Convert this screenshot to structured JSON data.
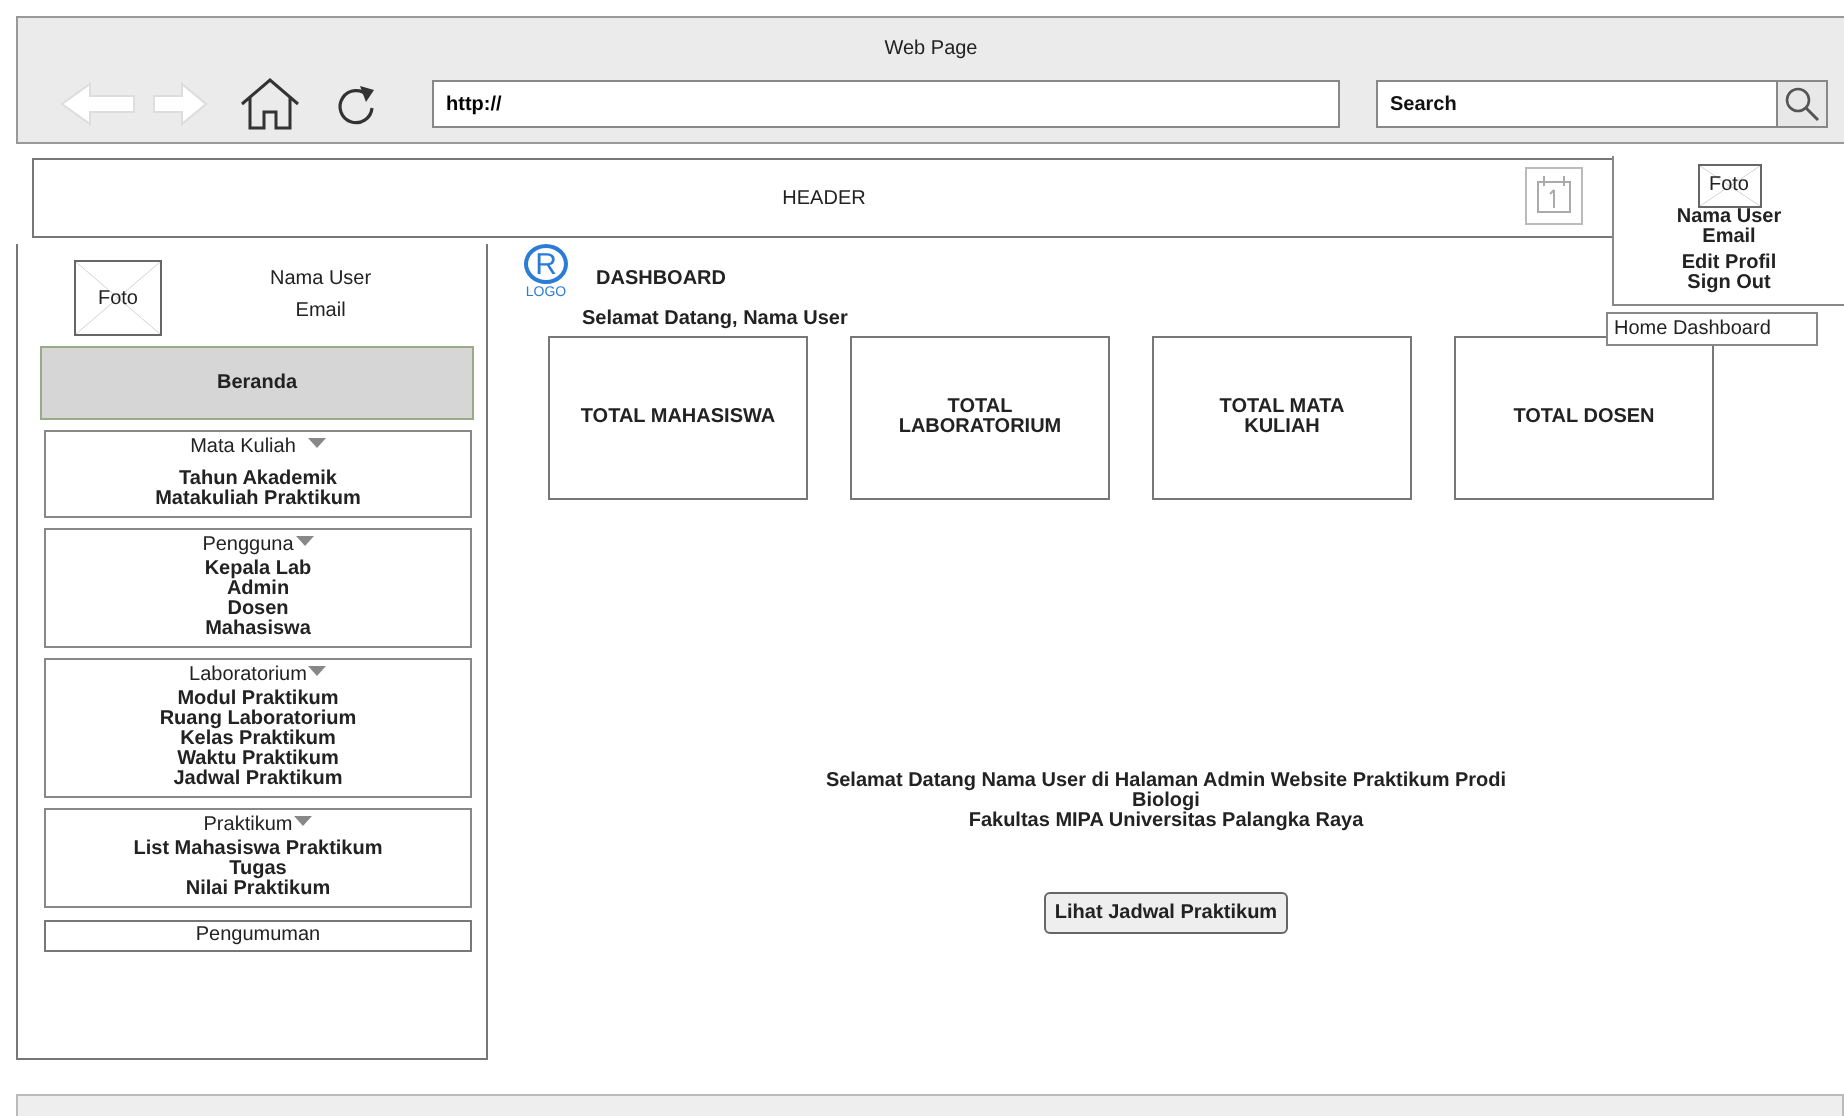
{
  "browser": {
    "title": "Web Page",
    "address": "http://",
    "search_placeholder": "Search"
  },
  "header": {
    "title": "HEADER"
  },
  "profile_menu": {
    "photo_label": "Foto",
    "name": "Nama User",
    "email": "Email",
    "items": [
      "Edit Profil",
      "Sign Out"
    ]
  },
  "home_link": "Home Dashboard",
  "sidebar": {
    "photo_label": "Foto",
    "name": "Nama User",
    "email": "Email",
    "menu": [
      {
        "kind": "link",
        "label": "Beranda",
        "selected": true
      },
      {
        "kind": "group",
        "label": "Mata Kuliah",
        "selected": false,
        "children": [
          {
            "label": "Tahun Akademik"
          },
          {
            "label": "Matakuliah Praktikum"
          }
        ]
      },
      {
        "kind": "group",
        "label": "Pengguna",
        "selected": false,
        "children": [
          {
            "label": "Kepala Lab"
          },
          {
            "label": "Admin"
          },
          {
            "label": "Dosen"
          },
          {
            "label": "Mahasiswa"
          }
        ]
      },
      {
        "kind": "group",
        "label": "Laboratorium",
        "selected": false,
        "children": [
          {
            "label": "Modul Praktikum"
          },
          {
            "label": "Ruang Laboratorium"
          },
          {
            "label": "Kelas Praktikum"
          },
          {
            "label": "Waktu Praktikum"
          },
          {
            "label": "Jadwal Praktikum"
          }
        ]
      },
      {
        "kind": "group",
        "label": "Praktikum",
        "selected": false,
        "children": [
          {
            "label": "List Mahasiswa Praktikum"
          },
          {
            "label": "Tugas"
          },
          {
            "label": "Nilai Praktikum"
          }
        ]
      },
      {
        "kind": "link",
        "label": "Pengumuman",
        "selected": false
      }
    ]
  },
  "main": {
    "logo": {
      "mark": "R",
      "caption": "LOGO"
    },
    "title": "DASHBOARD",
    "greeting": "Selamat Datang, Nama User",
    "stat_cards": [
      "TOTAL MAHASISWA",
      "TOTAL LABORATORIUM",
      "TOTAL MATA KULIAH",
      "TOTAL DOSEN"
    ],
    "welcome_lines": [
      "Selamat Datang Nama User di Halaman Admin Website Praktikum Prodi Biologi",
      "Fakultas MIPA Universitas Palangka Raya"
    ],
    "button": "Lihat Jadwal Praktikum"
  }
}
